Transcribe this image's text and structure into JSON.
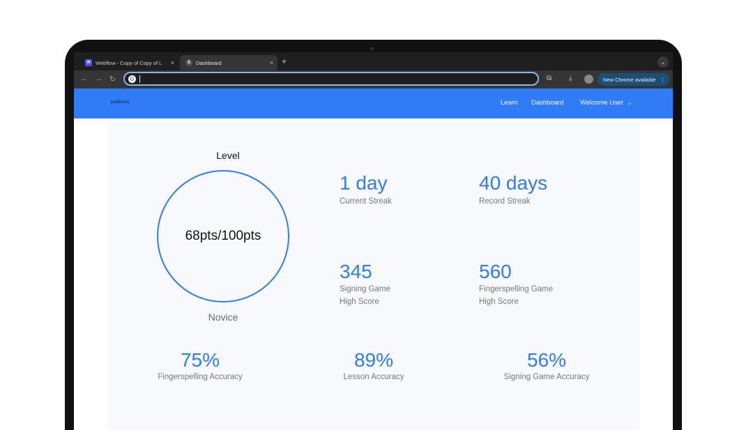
{
  "browser": {
    "tabs": [
      {
        "title": "Webflow - Copy of Copy of L",
        "favicon": "W"
      },
      {
        "title": "Dashboard",
        "favicon": "S"
      }
    ],
    "new_tab_symbol": "+",
    "tab_close_symbol": "×",
    "omnibox_value": "",
    "update_label": "New Chrome available",
    "accent_color": "#8ab4f8"
  },
  "site": {
    "logo": "[soldcore]",
    "nav": {
      "learn": "Learn",
      "dashboard": "Dashboard",
      "welcome": "Welcome User"
    },
    "brand_color": "#2f7cf6"
  },
  "dashboard": {
    "level_title": "Level",
    "level_progress": "68pts/100pts",
    "rank": "Novice",
    "current_streak": {
      "value": "1 day",
      "label": "Current Streak"
    },
    "record_streak": {
      "value": "40 days",
      "label": "Record Streak"
    },
    "signing_high_score": {
      "value": "345",
      "label_line1": "Signing Game",
      "label_line2": "High Score"
    },
    "fingerspelling_high_score": {
      "value": "560",
      "label_line1": "Fingerspelling Game",
      "label_line2": "High Score"
    },
    "fingerspelling_accuracy": {
      "value": "75%",
      "label": "Fingerspelling Accuracy"
    },
    "lesson_accuracy": {
      "value": "89%",
      "label": "Lesson Accuracy"
    },
    "signing_accuracy": {
      "value": "56%",
      "label": "Signing Game Accuracy"
    }
  }
}
